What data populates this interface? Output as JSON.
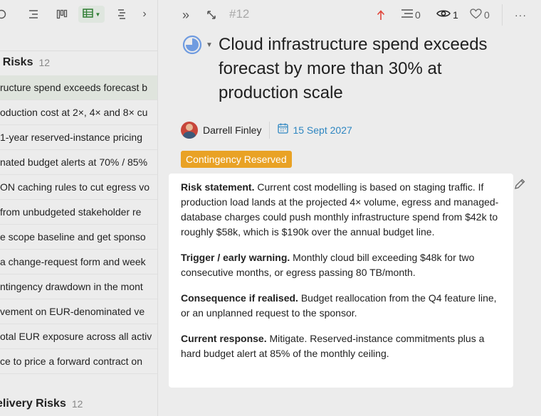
{
  "colors": {
    "background": "#ececec",
    "selected_row": "#dfe4dd",
    "badge": "#e9a225",
    "date": "#2e86c1",
    "priority_arrow": "#e0453a",
    "status_pie": "#6f9be0"
  },
  "left": {
    "toolbar": {
      "icons": [
        "circle-icon",
        "list-indent-icon",
        "board-columns-icon",
        "table-view-icon",
        "caret-down-icon",
        "timeline-icon",
        "chevron-right-icon"
      ],
      "chevron": "›"
    },
    "groups": [
      {
        "title": "t Risks",
        "count": "12",
        "rows": [
          "ructure spend exceeds forecast b",
          "oduction cost at 2×, 4× and 8× cu",
          " 1-year reserved-instance pricing",
          "nated budget alerts at 70% / 85%",
          "ON caching rules to cut egress vo",
          " from unbudgeted stakeholder re",
          "e scope baseline and get sponso",
          "a change-request form and week",
          "ntingency drawdown in the mont",
          "vement on EUR-denominated ve",
          "otal EUR exposure across all activ",
          "ce to price a forward contract on"
        ]
      },
      {
        "title": "elivery Risks",
        "count": "12"
      }
    ]
  },
  "right": {
    "toolbar": {
      "expand": "»",
      "issue_number": "#12",
      "subtasks_count": "0",
      "watchers_count": "1",
      "likes_count": "0",
      "more": "···"
    },
    "title": "Cloud infrastructure spend exceeds forecast by more than 30% at production scale",
    "status_progress": 0.75,
    "owner": "Darrell Finley",
    "due_date": "15 Sept 2027",
    "badge": "Contingency Reserved",
    "sections": [
      {
        "heading": "Risk statement.",
        "body": " Current cost modelling is based on staging traffic. If production load lands at the projected 4× volume, egress and managed-database charges could push monthly infrastructure spend from $42k to roughly $58k, which is $190k over the annual budget line."
      },
      {
        "heading": "Trigger / early warning.",
        "body": " Monthly cloud bill exceeding $48k for two consecutive months, or egress passing 80 TB/month."
      },
      {
        "heading": "Consequence if realised.",
        "body": " Budget reallocation from the Q4 feature line, or an unplanned request to the sponsor."
      },
      {
        "heading": "Current response.",
        "body": " Mitigate. Reserved-instance commitments plus a hard budget alert at 85% of the monthly ceiling."
      }
    ]
  }
}
